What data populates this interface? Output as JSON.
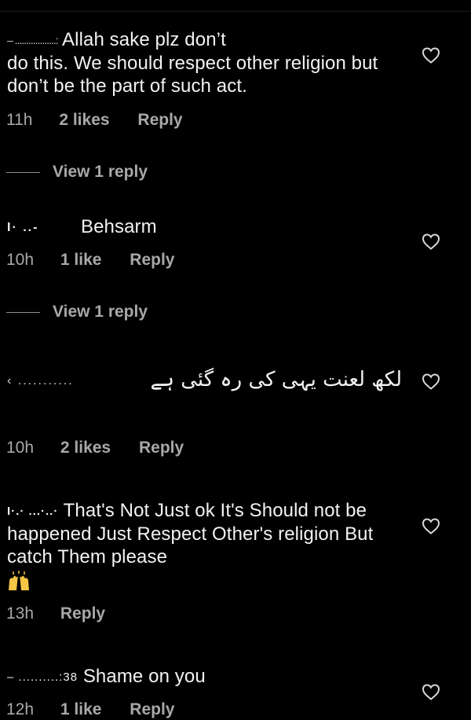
{
  "theme": {
    "background": "#000000",
    "text": "#f2f2f2",
    "muted": "#a8a8a8"
  },
  "comments": [
    {
      "username": "– ..................:",
      "text_line1": "Allah sake plz don’t",
      "text_rest": "do this. We should respect other religion but don’t be the part of such act.",
      "time": "11h",
      "likes": "2 likes",
      "reply": "Reply",
      "view_replies": "View 1 reply",
      "like_icon": "heart-outline-icon"
    },
    {
      "username": "I·   ..-",
      "text": "Behsarm",
      "time": "10h",
      "likes": "1 like",
      "reply": "Reply",
      "view_replies": "View 1 reply",
      "like_icon": "heart-outline-icon"
    },
    {
      "username": "‹  ...........",
      "text": "لکھ لعنت یہی کی رہ گئی ہے",
      "time": "10h",
      "likes": "2 likes",
      "reply": "Reply",
      "like_icon": "heart-outline-icon"
    },
    {
      "username": "I·.·   ...·..·",
      "text": "That's Not Just ok It's Should not be happened Just Respect Other's religion But catch Them please",
      "emoji": "raising-hands-emoji",
      "time": "13h",
      "reply": "Reply",
      "like_icon": "heart-outline-icon"
    },
    {
      "username": "– ..........:38",
      "text": "Shame on you",
      "time": "12h",
      "likes": "1 like",
      "reply": "Reply",
      "like_icon": "heart-outline-icon"
    }
  ]
}
